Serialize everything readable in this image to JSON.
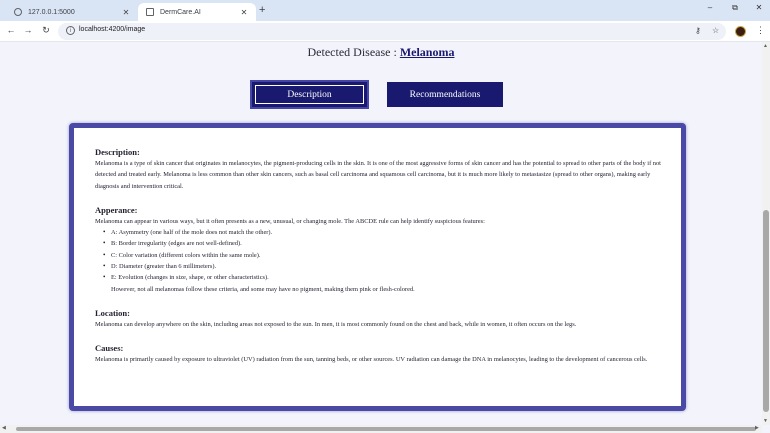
{
  "browser": {
    "tabs": [
      {
        "title": "127.0.0.1:5000",
        "icon": "globe-icon"
      },
      {
        "title": "DermCare.AI",
        "icon": "page-icon",
        "active": true
      }
    ],
    "new_tab": "+",
    "window_controls": {
      "minimize": "–",
      "restore": "⧉",
      "close": "✕"
    },
    "nav": {
      "back": "←",
      "forward": "→",
      "reload": "↻"
    },
    "url": "localhost:4200/image",
    "toolbar_icons": [
      "password-key-icon",
      "bookmark-star-icon",
      "profile-avatar",
      "menu-kebab-icon"
    ]
  },
  "page": {
    "heading_prefix": "Detected Disease : ",
    "disease": "Melanoma",
    "buttons": {
      "description": "Description",
      "recommendations": "Recommendations"
    },
    "active_button": "description",
    "sections": {
      "description": {
        "title": "Description:",
        "text": "Melanoma is a type of skin cancer that originates in melanocytes, the pigment-producing cells in the skin. It is one of the most aggressive forms of skin cancer and has the potential to spread to other parts of the body if not detected and treated early. Melanoma is less common than other skin cancers, such as basal cell carcinoma and squamous cell carcinoma, but it is much more likely to metastasize (spread to other organs), making early diagnosis and intervention critical."
      },
      "appearance": {
        "title": "Apperance:",
        "intro": "Melanoma can appear in various ways, but it often presents as a new, unusual, or changing mole. The ABCDE rule can help identify suspicious features:",
        "bullets": [
          "A: Asymmetry (one half of the mole does not match the other).",
          "B: Border irregularity (edges are not well-defined).",
          "C: Color variation (different colors within the same mole).",
          "D: Diameter (greater than 6 millimeters).",
          "E: Evolution (changes in size, shape, or other characteristics)."
        ],
        "note": "However, not all melanomas follow these criteria, and some may have no pigment, making them pink or flesh-colored."
      },
      "location": {
        "title": "Location:",
        "text": "Melanoma can develop anywhere on the skin, including areas not exposed to the sun. In men, it is most commonly found on the chest and back, while in women, it often occurs on the legs."
      },
      "causes": {
        "title": "Causes:",
        "text": "Melanoma is primarily caused by exposure to ultraviolet (UV) radiation from the sun, tanning beds, or other sources. UV radiation can damage the DNA in melanocytes, leading to the development of cancerous cells."
      }
    }
  },
  "colors": {
    "accent": "#191970",
    "card_border": "#4a4aa6",
    "page_bg": "#f3f3fb"
  }
}
